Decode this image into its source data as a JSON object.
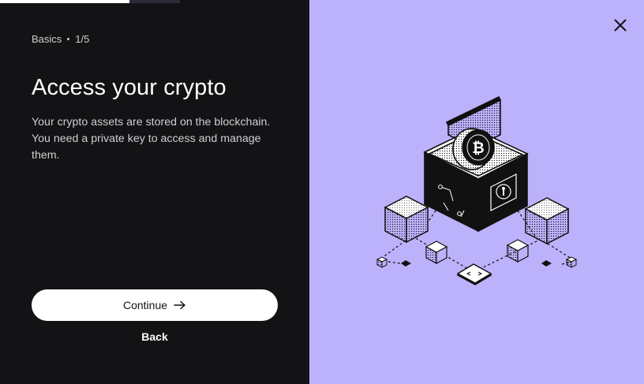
{
  "progress": {
    "current_step": 1,
    "total_steps": 5,
    "fraction": 0.2
  },
  "step_indicator": {
    "section": "Basics",
    "position": "1/5"
  },
  "title": "Access your crypto",
  "description": "Your crypto assets are stored on the blockchain. You need a private key to access and manage them.",
  "buttons": {
    "continue_label": "Continue",
    "back_label": "Back"
  },
  "icons": {
    "close": "close-icon",
    "continue": "arrow-right-icon",
    "illustration": "treasure-chest-bitcoin-blockchain"
  },
  "colors": {
    "left_background": "#131214",
    "right_background": "#bcb2fb",
    "button_background": "#ffffff",
    "text": "#ffffff"
  }
}
